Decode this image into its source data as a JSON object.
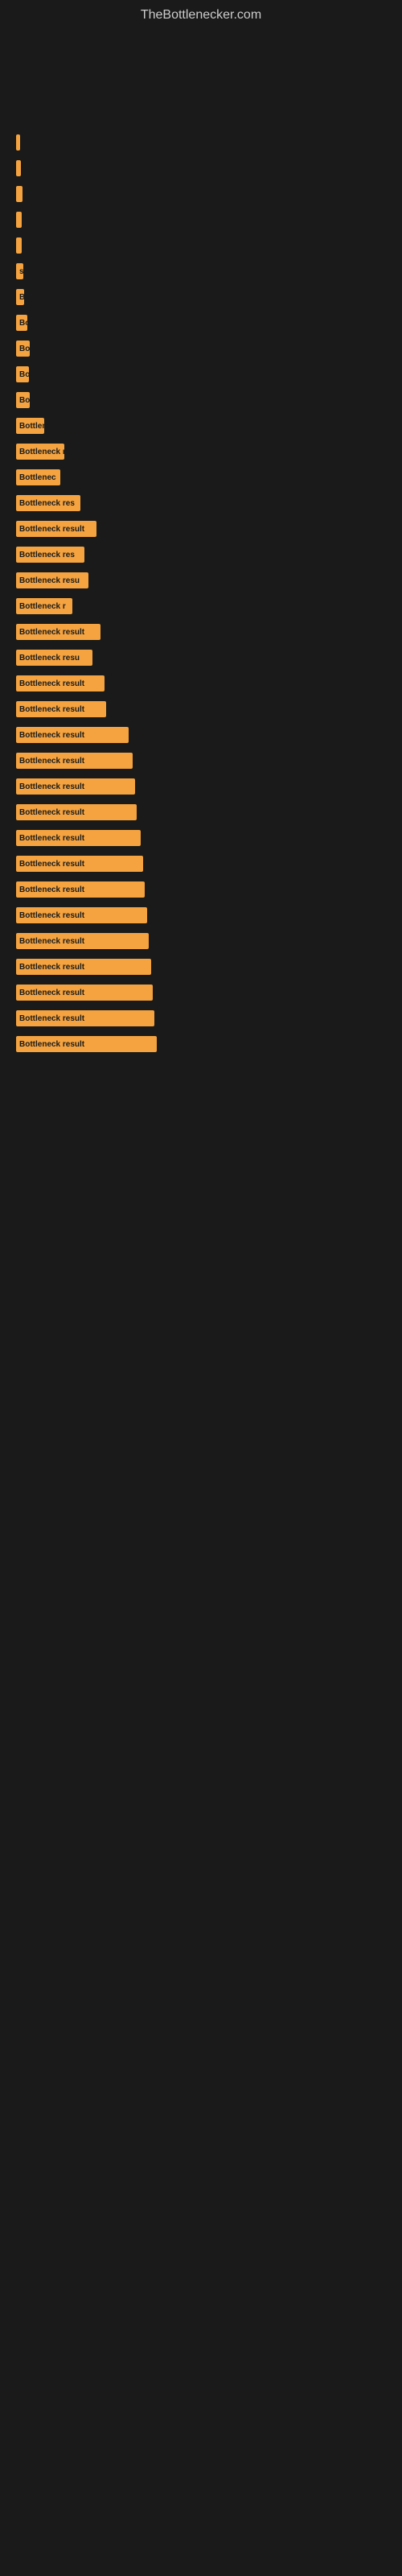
{
  "site": {
    "title": "TheBottlenecker.com"
  },
  "chart": {
    "bars": [
      {
        "label": "",
        "text": "",
        "width": 5
      },
      {
        "label": "",
        "text": "",
        "width": 6
      },
      {
        "label": "",
        "text": "",
        "width": 8
      },
      {
        "label": "",
        "text": "",
        "width": 7
      },
      {
        "label": "",
        "text": "",
        "width": 7
      },
      {
        "label": "",
        "text": "s",
        "width": 9
      },
      {
        "label": "",
        "text": "B",
        "width": 10
      },
      {
        "label": "",
        "text": "Bo",
        "width": 14
      },
      {
        "label": "",
        "text": "Bot",
        "width": 17
      },
      {
        "label": "",
        "text": "Bo",
        "width": 16
      },
      {
        "label": "",
        "text": "Bot",
        "width": 17
      },
      {
        "label": "",
        "text": "Bottlene",
        "width": 35
      },
      {
        "label": "",
        "text": "Bottleneck re",
        "width": 60
      },
      {
        "label": "",
        "text": "Bottlenec",
        "width": 55
      },
      {
        "label": "",
        "text": "Bottleneck res",
        "width": 80
      },
      {
        "label": "",
        "text": "Bottleneck result",
        "width": 100
      },
      {
        "label": "",
        "text": "Bottleneck res",
        "width": 85
      },
      {
        "label": "",
        "text": "Bottleneck resu",
        "width": 90
      },
      {
        "label": "",
        "text": "Bottleneck r",
        "width": 70
      },
      {
        "label": "",
        "text": "Bottleneck result",
        "width": 105
      },
      {
        "label": "",
        "text": "Bottleneck resu",
        "width": 95
      },
      {
        "label": "",
        "text": "Bottleneck result",
        "width": 110
      },
      {
        "label": "",
        "text": "Bottleneck result",
        "width": 112
      },
      {
        "label": "",
        "text": "Bottleneck result",
        "width": 140
      },
      {
        "label": "",
        "text": "Bottleneck result",
        "width": 145
      },
      {
        "label": "",
        "text": "Bottleneck result",
        "width": 148
      },
      {
        "label": "",
        "text": "Bottleneck result",
        "width": 150
      },
      {
        "label": "",
        "text": "Bottleneck result",
        "width": 155
      },
      {
        "label": "",
        "text": "Bottleneck result",
        "width": 158
      },
      {
        "label": "",
        "text": "Bottleneck result",
        "width": 160
      },
      {
        "label": "",
        "text": "Bottleneck result",
        "width": 163
      },
      {
        "label": "",
        "text": "Bottleneck result",
        "width": 165
      },
      {
        "label": "",
        "text": "Bottleneck result",
        "width": 168
      },
      {
        "label": "",
        "text": "Bottleneck result",
        "width": 170
      },
      {
        "label": "",
        "text": "Bottleneck result",
        "width": 172
      },
      {
        "label": "",
        "text": "Bottleneck result",
        "width": 175
      }
    ]
  }
}
